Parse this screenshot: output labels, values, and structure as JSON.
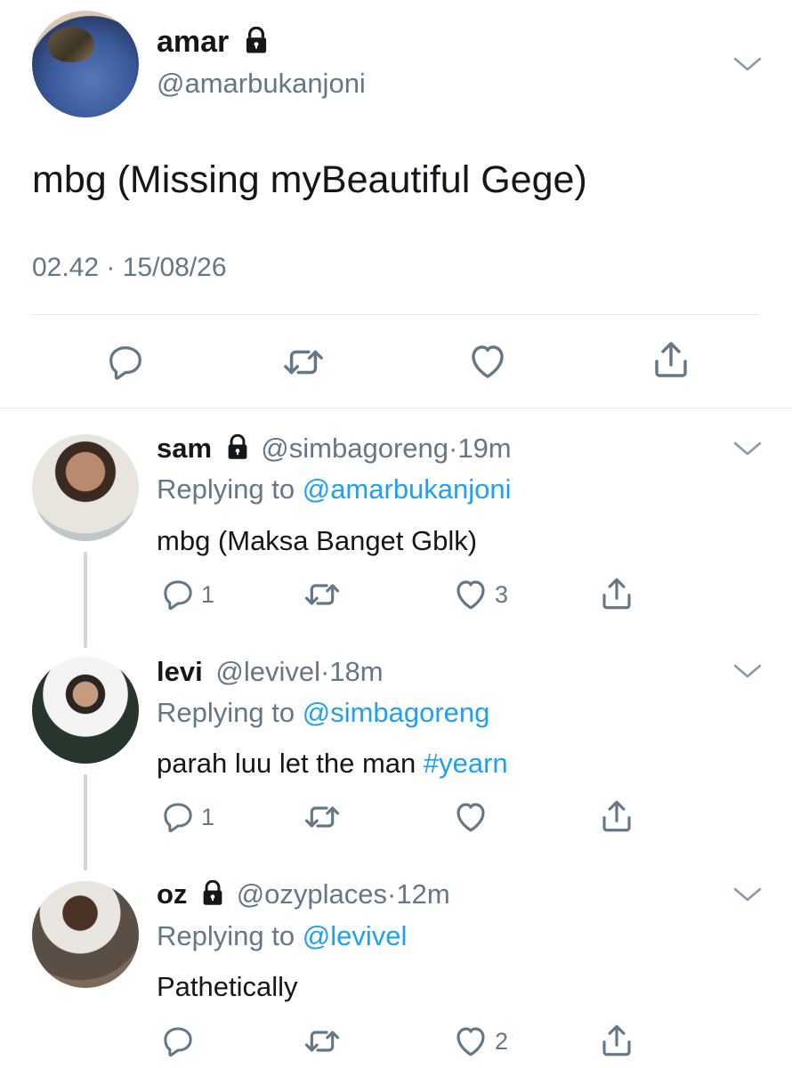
{
  "main_tweet": {
    "name": "amar",
    "handle": "@amarbukanjoni",
    "text": "mbg (Missing myBeautiful Gege)",
    "timestamp": "02.42 · 15/08/26",
    "actions": [
      "reply-icon",
      "retweet-icon",
      "like-icon",
      "share-icon"
    ]
  },
  "replies": [
    {
      "name": "sam",
      "locked": true,
      "handle": "@simbagoreng",
      "time": "19m",
      "replying_prefix": "Replying to ",
      "replying_to": "@amarbukanjoni",
      "text": "mbg (Maksa Banget Gblk)",
      "reply_count": "1",
      "retweet_count": "",
      "like_count": "3"
    },
    {
      "name": "levi",
      "locked": false,
      "handle": "@levivel",
      "time": "18m",
      "replying_prefix": "Replying to ",
      "replying_to": "@simbagoreng",
      "text": "parah luu let the man ",
      "hashtag": "#yearn",
      "reply_count": "1",
      "retweet_count": "",
      "like_count": ""
    },
    {
      "name": "oz",
      "locked": true,
      "handle": "@ozyplaces",
      "time": "12m",
      "replying_prefix": "Replying to ",
      "replying_to": "@levivel",
      "text": "Pathetically",
      "reply_count": "",
      "retweet_count": "",
      "like_count": "2"
    }
  ],
  "dot": "·",
  "colors": {
    "link": "#1da1f2",
    "secondary": "#657786",
    "divider": "#e1e8ed"
  }
}
